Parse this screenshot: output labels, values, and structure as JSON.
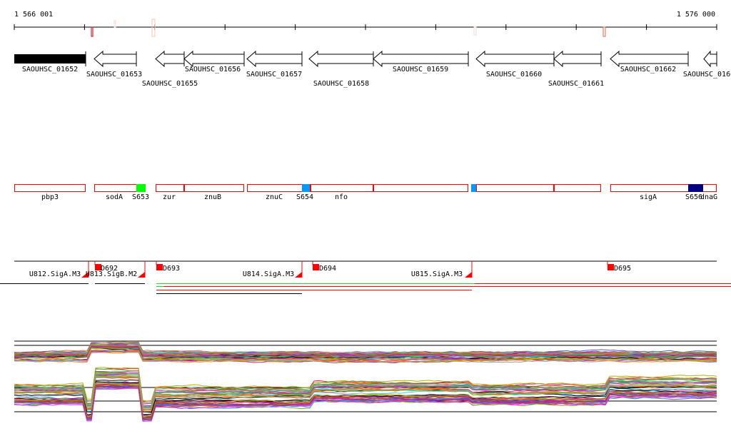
{
  "ruler": {
    "start_label": "1 566 001",
    "end_label": "1 576 000"
  },
  "genes": [
    {
      "id": "SAOUHSC_01652",
      "style": "filled"
    },
    {
      "id": "SAOUHSC_01653"
    },
    {
      "id": "SAOUHSC_01655"
    },
    {
      "id": "SAOUHSC_01656"
    },
    {
      "id": "SAOUHSC_01657"
    },
    {
      "id": "SAOUHSC_01658"
    },
    {
      "id": "SAOUHSC_01659"
    },
    {
      "id": "SAOUHSC_01660"
    },
    {
      "id": "SAOUHSC_01661"
    },
    {
      "id": "SAOUHSC_01662"
    },
    {
      "id": "SAOUHSC_0166"
    }
  ],
  "operon_labels": [
    "pbp3",
    "sodA",
    "S653",
    "zur",
    "znuB",
    "znuC",
    "S654",
    "nfo",
    "sigA",
    "S656",
    "dnaG"
  ],
  "promoters": [
    "U812.SigA.M3",
    "U813.SigB.M2",
    "U814.SigA.M3",
    "U815.SigA.M3"
  ],
  "terminators": [
    "D692",
    "D693",
    "D694",
    "D695"
  ],
  "colors": {
    "feature": "#ff0000",
    "green": "#00ff00",
    "blue": "#0099ff",
    "navy": "#000080",
    "tu_green": "#22dd22"
  }
}
